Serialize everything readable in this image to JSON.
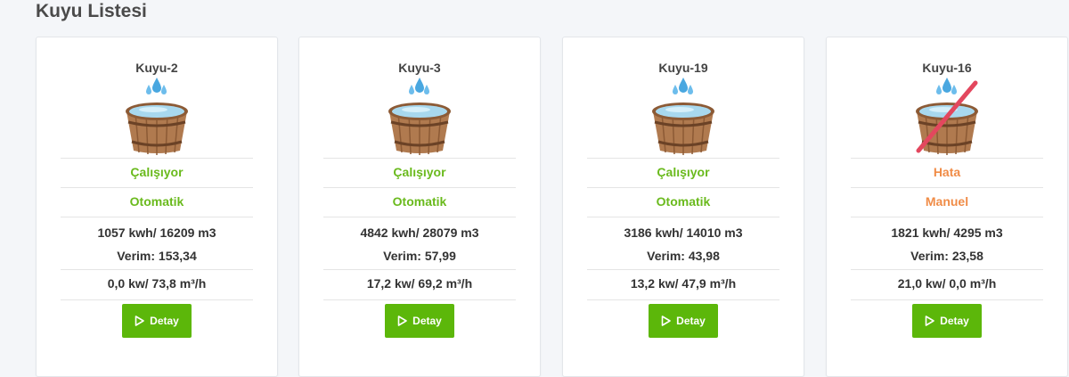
{
  "page_title": "Kuyu Listesi",
  "colors": {
    "ok": "#6aba1d",
    "error": "#f08c47",
    "button": "#5cb70a"
  },
  "wells": [
    {
      "name": "Kuyu-2",
      "status": "Çalışıyor",
      "mode": "Otomatik",
      "energy": "1057 kwh/ 16209 m3",
      "efficiency": "Verim: 153,34",
      "power": "0,0 kw/ 73,8 m³/h",
      "button_label": "Detay",
      "state": "ok"
    },
    {
      "name": "Kuyu-3",
      "status": "Çalışıyor",
      "mode": "Otomatik",
      "energy": "4842 kwh/ 28079 m3",
      "efficiency": "Verim: 57,99",
      "power": "17,2 kw/ 69,2 m³/h",
      "button_label": "Detay",
      "state": "ok"
    },
    {
      "name": "Kuyu-19",
      "status": "Çalışıyor",
      "mode": "Otomatik",
      "energy": "3186 kwh/ 14010 m3",
      "efficiency": "Verim: 43,98",
      "power": "13,2 kw/ 47,9 m³/h",
      "button_label": "Detay",
      "state": "ok"
    },
    {
      "name": "Kuyu-16",
      "status": "Hata",
      "mode": "Manuel",
      "energy": "1821 kwh/ 4295 m3",
      "efficiency": "Verim: 23,58",
      "power": "21,0 kw/ 0,0 m³/h",
      "button_label": "Detay",
      "state": "error"
    }
  ]
}
